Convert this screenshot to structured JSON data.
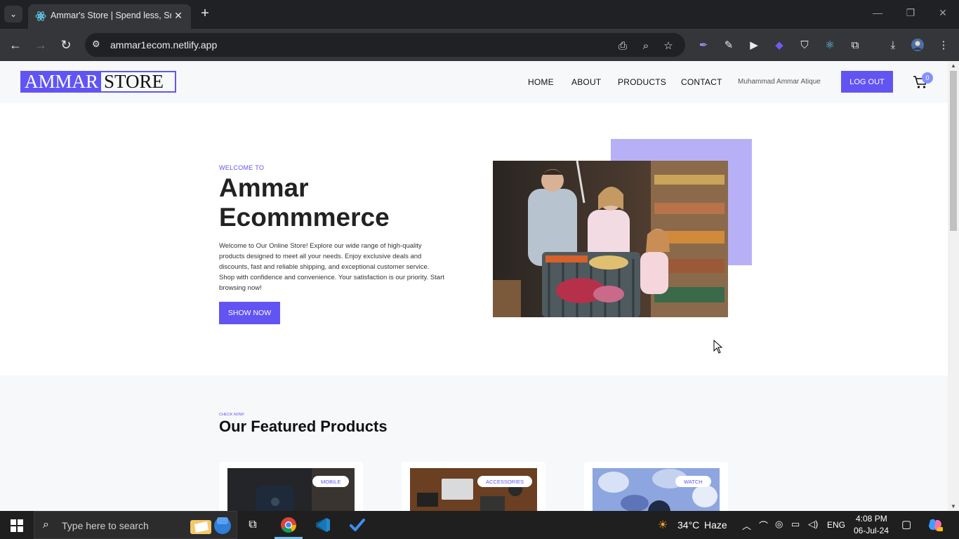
{
  "browser": {
    "tab_title": "Ammar's Store | Spend less, Smile more",
    "url": "ammar1ecom.netlify.app",
    "new_tab": "+",
    "tab_close": "✕"
  },
  "header": {
    "logo_part1": "AMMAR",
    "logo_part2": "STORE",
    "nav": [
      "HOME",
      "ABOUT",
      "PRODUCTS",
      "CONTACT"
    ],
    "username": "Muhammad Ammar Atique",
    "logout_label": "LOG OUT",
    "cart_count": "0"
  },
  "hero": {
    "welcome": "WELCOME TO",
    "title_line1": "Ammar",
    "title_line2": "Ecommmerce",
    "description": "Welcome to Our Online Store! Explore our wide range of high-quality products designed to meet all your needs. Enjoy exclusive deals and discounts, fast and reliable shipping, and exceptional customer service. Shop with confidence and convenience. Your satisfaction is our priority. Start browsing now!",
    "button_label": "SHOW NOW"
  },
  "featured": {
    "subtitle": "CHECK NOW!",
    "title": "Our Featured Products",
    "cards": [
      {
        "tag": "MOBILE"
      },
      {
        "tag": "ACCESSORIES"
      },
      {
        "tag": "WATCH"
      }
    ]
  },
  "taskbar": {
    "search_placeholder": "Type here to search",
    "weather_temp": "34°C",
    "weather_text": "Haze",
    "language": "ENG",
    "time": "4:08 PM",
    "date": "06-Jul-24"
  },
  "colors": {
    "accent": "#6254f3",
    "accent_light": "#b8b0f6",
    "section_bg": "#f6f8fa"
  }
}
